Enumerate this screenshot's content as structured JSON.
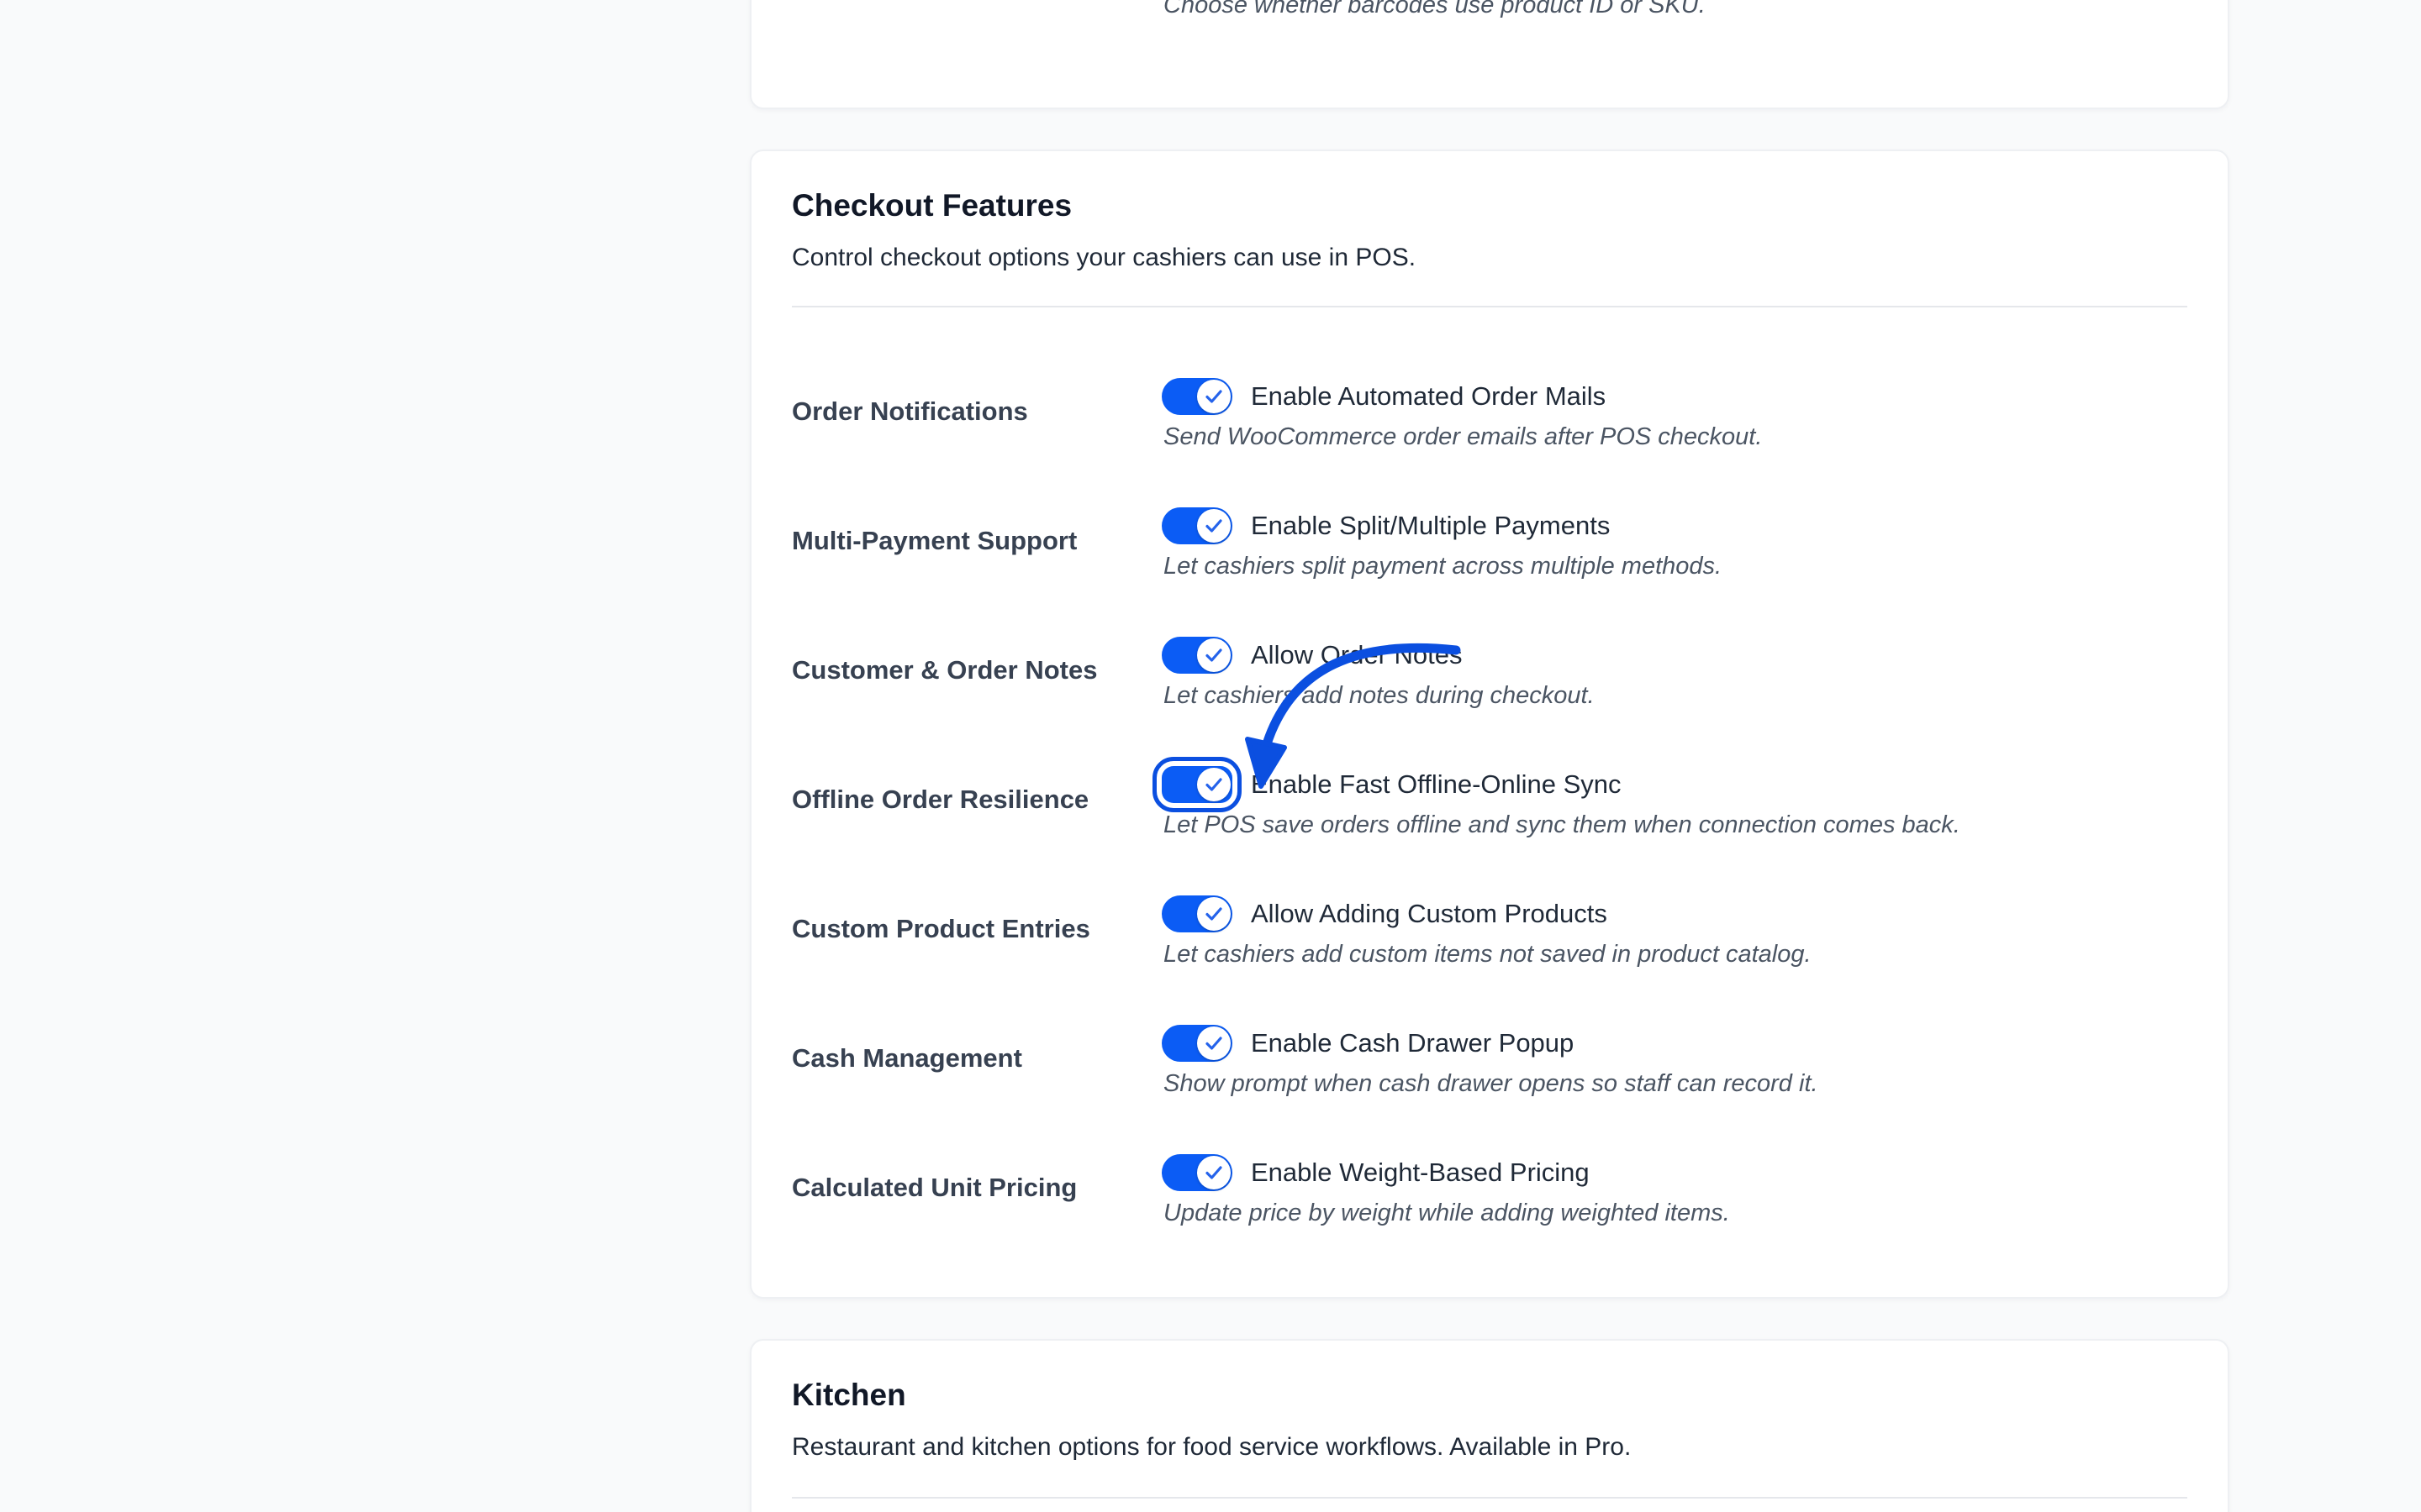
{
  "top_card": {
    "helper": "Choose whether barcodes use product ID or SKU."
  },
  "checkout": {
    "title": "Checkout Features",
    "description": "Control checkout options your cashiers can use in POS.",
    "rows": [
      {
        "label": "Order Notifications",
        "option": "Enable Automated Order Mails",
        "help": "Send WooCommerce order emails after POS checkout.",
        "enabled": true
      },
      {
        "label": "Multi-Payment Support",
        "option": "Enable Split/Multiple Payments",
        "help": "Let cashiers split payment across multiple methods.",
        "enabled": true
      },
      {
        "label": "Customer & Order Notes",
        "option": "Allow Order Notes",
        "help": "Let cashiers add notes during checkout.",
        "enabled": true
      },
      {
        "label": "Offline Order Resilience",
        "option": "Enable Fast Offline-Online Sync",
        "help": "Let POS save orders offline and sync them when connection comes back.",
        "enabled": true,
        "highlighted": true
      },
      {
        "label": "Custom Product Entries",
        "option": "Allow Adding Custom Products",
        "help": "Let cashiers add custom items not saved in product catalog.",
        "enabled": true
      },
      {
        "label": "Cash Management",
        "option": "Enable Cash Drawer Popup",
        "help": "Show prompt when cash drawer opens so staff can record it.",
        "enabled": true
      },
      {
        "label": "Calculated Unit Pricing",
        "option": "Enable Weight-Based Pricing",
        "help": "Update price by weight while adding weighted items.",
        "enabled": true
      }
    ]
  },
  "kitchen": {
    "title": "Kitchen",
    "description": "Restaurant and kitchen options for food service workflows. Available in Pro."
  },
  "colors": {
    "accent": "#0b5cf5",
    "annotation": "#0b4fe0",
    "check": "#2563eb"
  },
  "icons": {
    "toggle_check": "checkmark-icon",
    "annotation": "curved-arrow-icon"
  }
}
